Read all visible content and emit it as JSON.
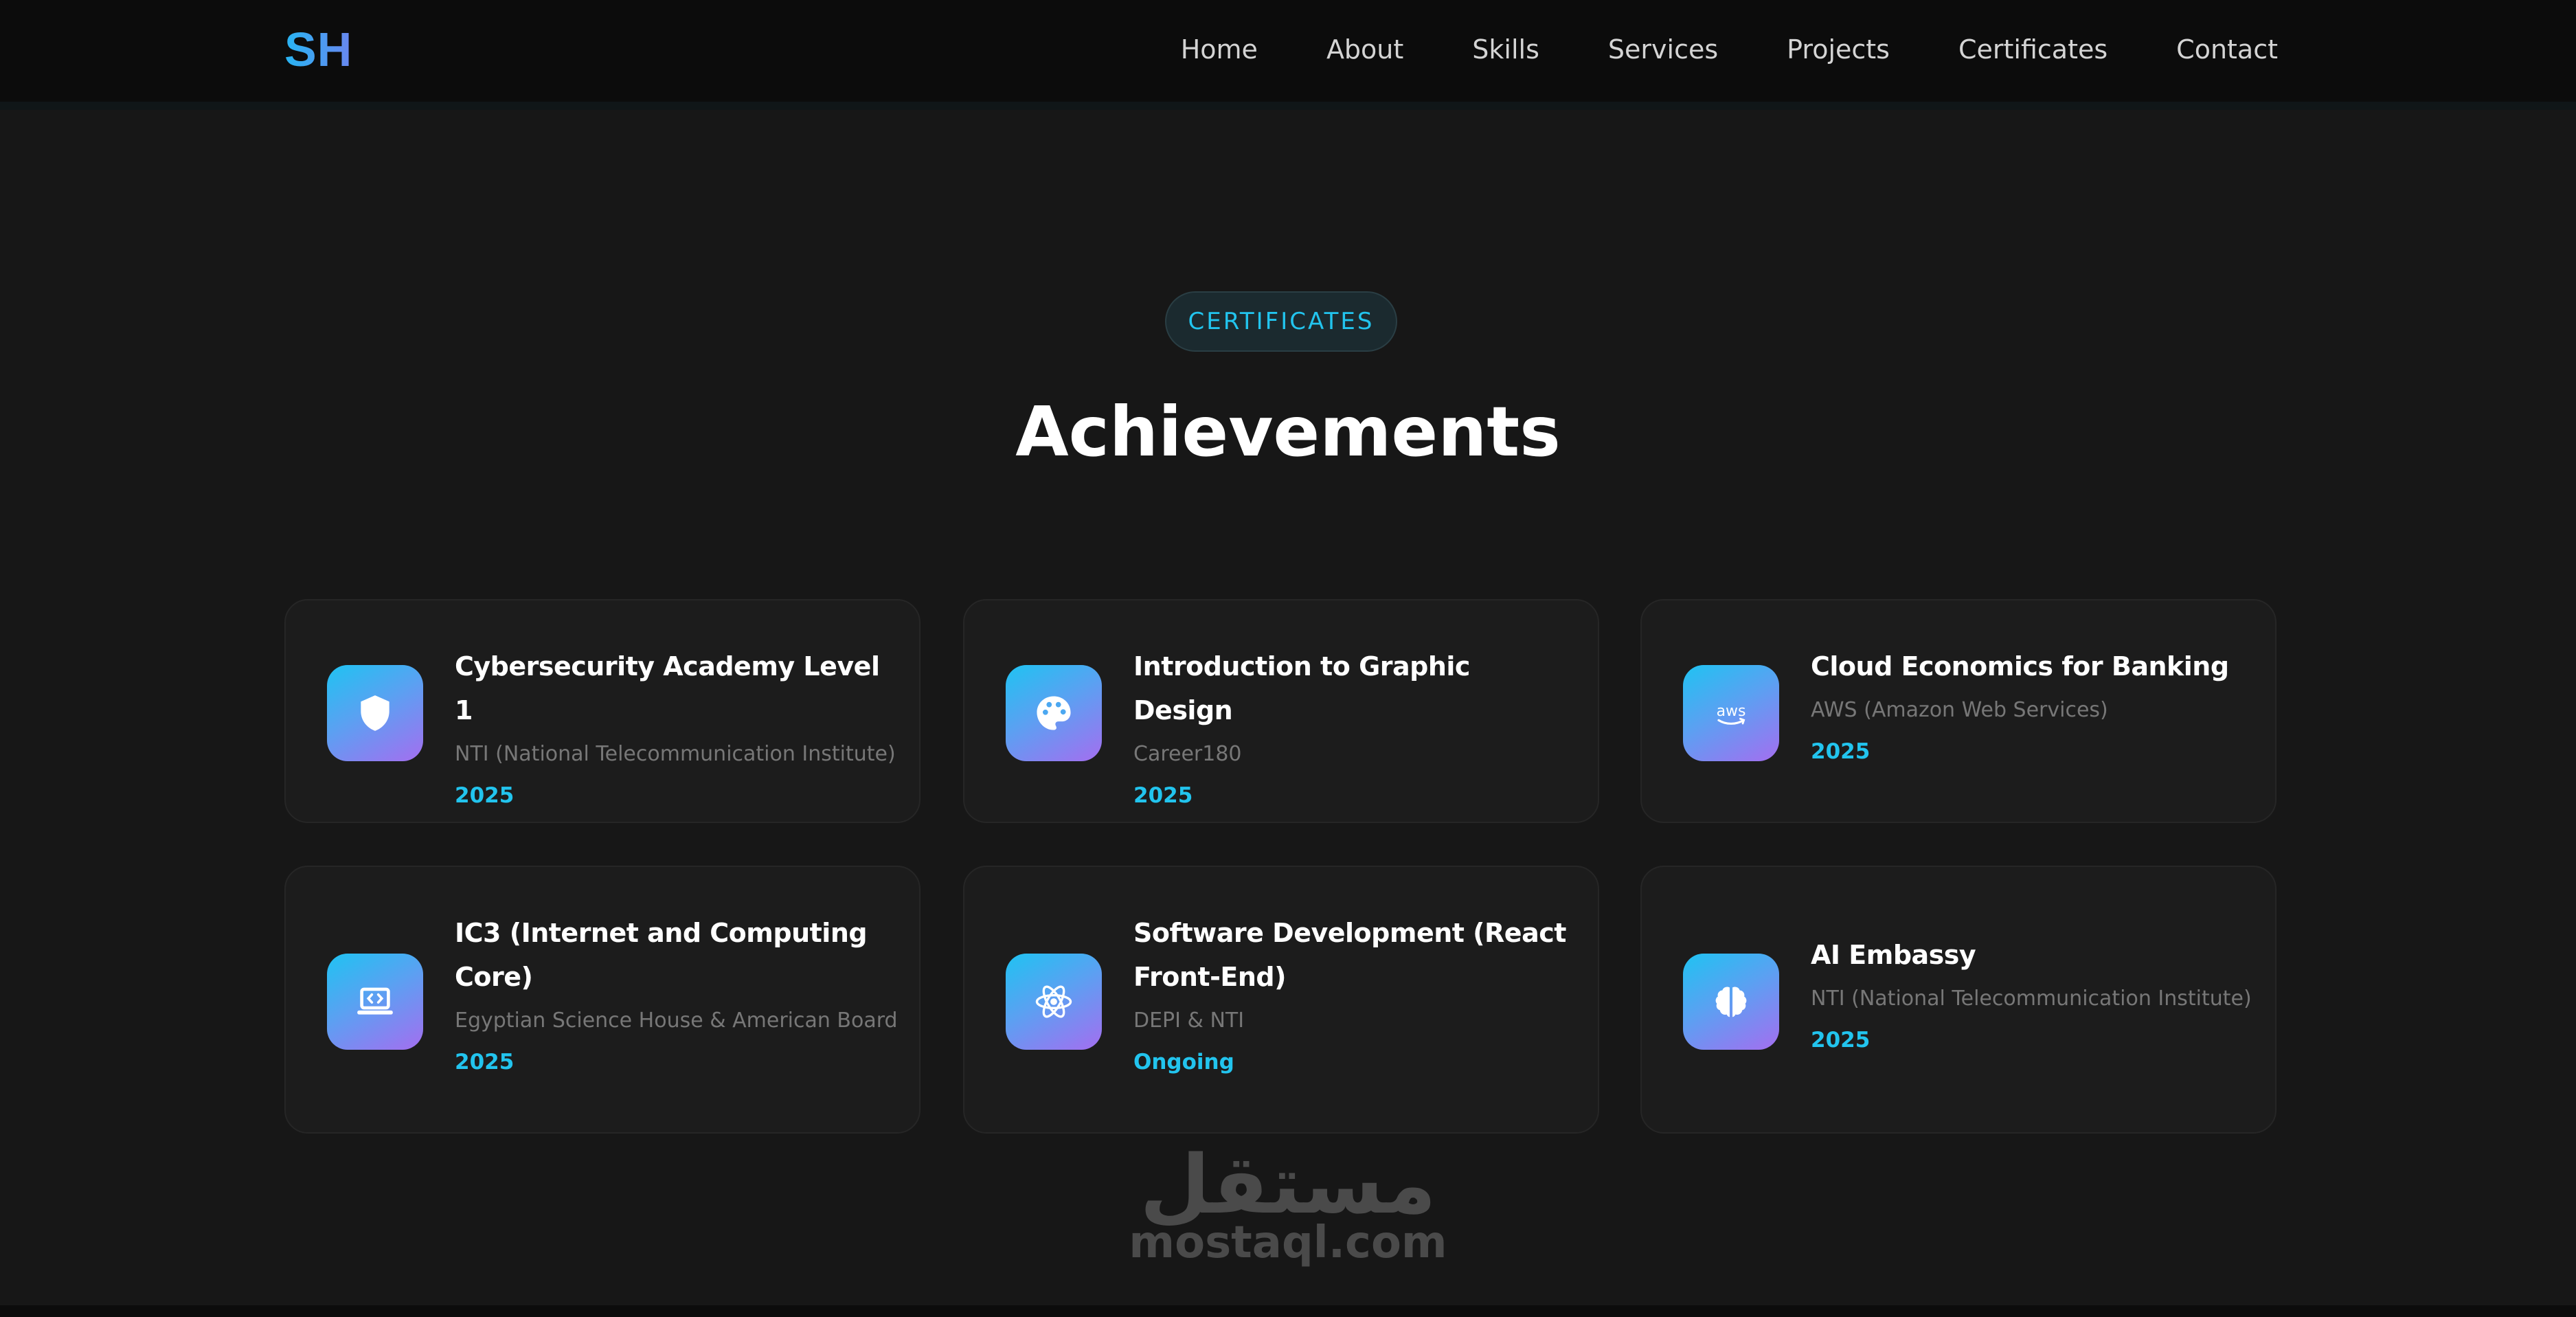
{
  "header": {
    "logo": "SH",
    "nav": [
      "Home",
      "About",
      "Skills",
      "Services",
      "Projects",
      "Certificates",
      "Contact"
    ]
  },
  "section": {
    "badge": "CERTIFICATES",
    "title": "Achievements"
  },
  "certificates": [
    {
      "title": "Cybersecurity Academy Level 1",
      "issuer": "NTI (National Telecommunication Institute)",
      "year": "2025",
      "icon": "shield-icon"
    },
    {
      "title": "Introduction to Graphic Design",
      "issuer": "Career180",
      "year": "2025",
      "icon": "palette-icon"
    },
    {
      "title": "Cloud Economics for Banking",
      "issuer": "AWS (Amazon Web Services)",
      "year": "2025",
      "icon": "aws-icon",
      "icon_text": "aws"
    },
    {
      "title": "IC3 (Internet and Computing Core)",
      "issuer": "Egyptian Science House & American Board",
      "year": "2025",
      "icon": "laptop-code-icon"
    },
    {
      "title": "Software Development (React Front-End)",
      "issuer": "DEPI & NTI",
      "year": "Ongoing",
      "icon": "react-icon"
    },
    {
      "title": "AI Embassy",
      "issuer": "NTI (National Telecommunication Institute)",
      "year": "2025",
      "icon": "brain-icon"
    }
  ],
  "watermark": {
    "arabic": "مستقل",
    "domain": "mostaql.com"
  },
  "colors": {
    "accent": "#22c4ee",
    "background": "#171717",
    "card": "#1c1c1c",
    "gradient_start": "#1fc3f2",
    "gradient_end": "#a46ef0"
  }
}
